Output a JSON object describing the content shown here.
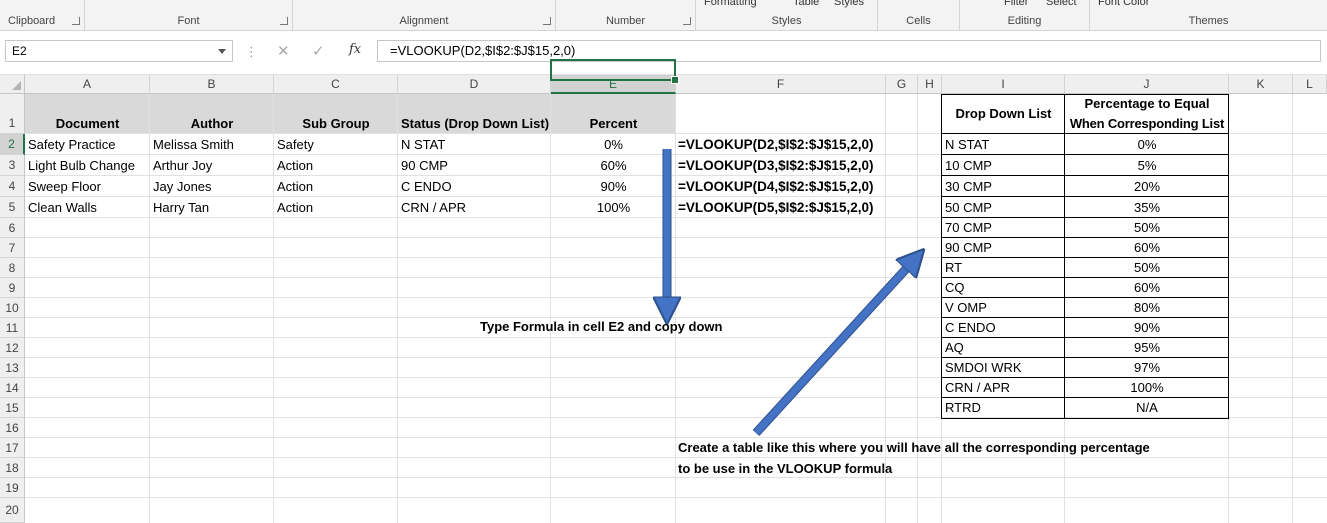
{
  "ribbon": {
    "groups": [
      "Clipboard",
      "Font",
      "Alignment",
      "Number",
      "Styles",
      "Cells",
      "Editing",
      "Themes"
    ],
    "cut_labels": [
      "Formatting",
      "Table",
      "Styles",
      "Filter",
      "Select",
      "Font Color"
    ]
  },
  "formula_bar": {
    "name_box": "E2",
    "formula": "=VLOOKUP(D2,$I$2:$J$15,2,0)",
    "fx_label": "fx"
  },
  "columns": [
    "A",
    "B",
    "C",
    "D",
    "E",
    "F",
    "G",
    "H",
    "I",
    "J",
    "K",
    "L"
  ],
  "rows": [
    "1",
    "2",
    "3",
    "4",
    "5",
    "6",
    "7",
    "8",
    "9",
    "10",
    "11",
    "12",
    "13",
    "14",
    "15",
    "16",
    "17",
    "18",
    "19",
    "20"
  ],
  "main_table": {
    "headers": [
      "Document",
      "Author",
      "Sub Group",
      "Status (Drop Down List)",
      "Percent"
    ],
    "rows": [
      [
        "Safety Practice",
        "Melissa Smith",
        "Safety",
        "N STAT",
        "0%"
      ],
      [
        "Light Bulb Change",
        "Arthur Joy",
        "Action",
        "90 CMP",
        "60%"
      ],
      [
        "Sweep Floor",
        "Jay Jones",
        "Action",
        "C ENDO",
        "90%"
      ],
      [
        "Clean Walls",
        "Harry Tan",
        "Action",
        "CRN / APR",
        "100%"
      ]
    ],
    "formulas": [
      "=VLOOKUP(D2,$I$2:$J$15,2,0)",
      "=VLOOKUP(D3,$I$2:$J$15,2,0)",
      "=VLOOKUP(D4,$I$2:$J$15,2,0)",
      "=VLOOKUP(D5,$I$2:$J$15,2,0)"
    ]
  },
  "lookup_table": {
    "header_list": "Drop Down List",
    "header_pct_1": "Percentage to Equal",
    "header_pct_2": "When Corresponding List",
    "rows": [
      [
        "N STAT",
        "0%"
      ],
      [
        "10 CMP",
        "5%"
      ],
      [
        "30 CMP",
        "20%"
      ],
      [
        "50 CMP",
        "35%"
      ],
      [
        "70 CMP",
        "50%"
      ],
      [
        "90 CMP",
        "60%"
      ],
      [
        "RT",
        "50%"
      ],
      [
        "CQ",
        "60%"
      ],
      [
        "V OMP",
        "80%"
      ],
      [
        "C ENDO",
        "90%"
      ],
      [
        "AQ",
        "95%"
      ],
      [
        "SMDOI WRK",
        "97%"
      ],
      [
        "CRN / APR",
        "100%"
      ],
      [
        "RTRD",
        "N/A"
      ]
    ]
  },
  "notes": {
    "formula_note": "Type Formula in cell E2 and copy down",
    "table_note_1": "Create a table like this where you will have all the corresponding percentage",
    "table_note_2": "to be use in the VLOOKUP formula"
  },
  "colors": {
    "excel_green": "#217346",
    "arrow_blue": "#4472c4",
    "header_fill": "#d9d9d9"
  }
}
